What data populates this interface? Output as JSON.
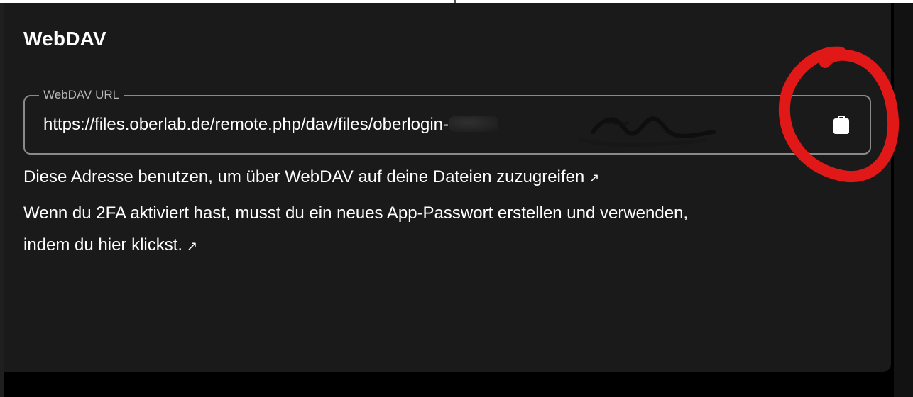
{
  "section": {
    "title": "WebDAV"
  },
  "url_field": {
    "label": "WebDAV URL",
    "value": "https://files.oberlab.de/remote.php/dav/files/oberlogin-"
  },
  "icons": {
    "copy": "clipboard-icon",
    "arrow": "arrow-up-right-icon"
  },
  "info": {
    "line1": "Diese Adresse benutzen, um über WebDAV auf deine Dateien zuzugreifen",
    "line2": "Wenn du 2FA aktiviert hast, musst du ein neues App-Passwort erstellen und verwenden,",
    "line3": "indem du hier klickst.",
    "arrow_glyph": "↗"
  },
  "colors": {
    "panel_background": "#1a1a1a",
    "text": "#ffffff",
    "field_border": "#8a8a8a",
    "annotation": "#e01818"
  }
}
